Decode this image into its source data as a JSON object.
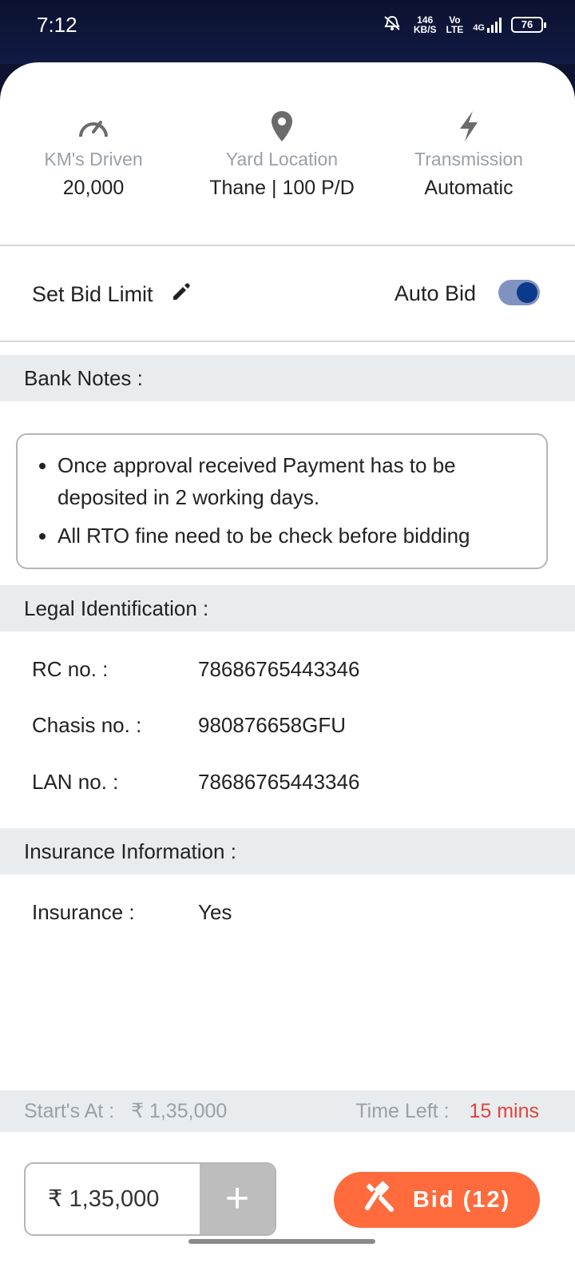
{
  "status_bar": {
    "time": "7:12",
    "net_speed_top": "146",
    "net_speed_bottom": "KB/S",
    "volte_top": "Vo",
    "volte_bottom": "LTE",
    "network": "4G",
    "battery": "76"
  },
  "specs": [
    {
      "icon": "speedometer-icon",
      "label": "KM's Driven",
      "value": "20,000"
    },
    {
      "icon": "location-pin-icon",
      "label": "Yard Location",
      "value": "Thane | 100  P/D"
    },
    {
      "icon": "lightning-icon",
      "label": "Transmission",
      "value": "Automatic"
    }
  ],
  "bid_controls": {
    "set_bid_limit_label": "Set Bid Limit",
    "auto_bid_label": "Auto Bid",
    "auto_bid_enabled": true
  },
  "bank_notes": {
    "title": "Bank Notes :",
    "items": [
      "Once approval received Payment has to be deposited in 2 working days.",
      "All RTO fine need to be check before bidding"
    ]
  },
  "legal": {
    "title": "Legal Identification :",
    "rows": [
      {
        "key": "RC no. :",
        "value": "78686765443346"
      },
      {
        "key": "Chasis no. :",
        "value": "980876658GFU"
      },
      {
        "key": "LAN no. :",
        "value": "78686765443346"
      }
    ]
  },
  "insurance": {
    "title": "Insurance Information :",
    "rows": [
      {
        "key": "Insurance :",
        "value": "Yes"
      }
    ]
  },
  "summary": {
    "starts_at_label": "Start's At :",
    "starts_at_value": "₹ 1,35,000",
    "time_left_label": "Time Left :",
    "time_left_value": "15 mins",
    "accent_color": "#e0433a"
  },
  "bid_footer": {
    "amount": "₹ 1,35,000",
    "plus_label": "+",
    "bid_label": "Bid (12)",
    "bid_color": "#ff6b3c"
  }
}
